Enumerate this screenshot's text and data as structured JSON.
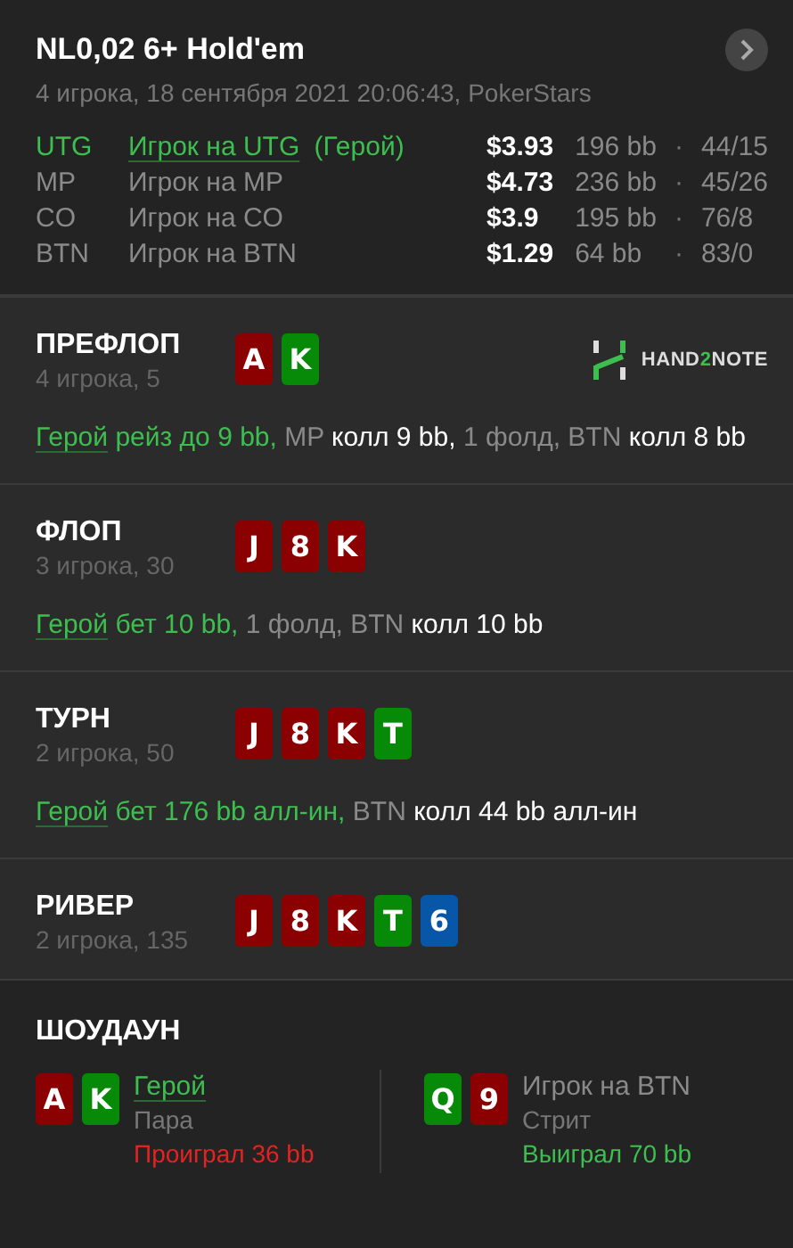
{
  "header": {
    "title": "NL0,02 6+ Hold'em",
    "subtitle": "4 игрока, 18 сентября 2021 20:06:43, PokerStars"
  },
  "players": [
    {
      "position": "UTG",
      "name": "Игрок на UTG",
      "hero_tag": "(Герой)",
      "hero": true,
      "stack": "$3.93",
      "bb": "196 bb",
      "separator": "·",
      "stats": "44/15"
    },
    {
      "position": "MP",
      "name": "Игрок на MP",
      "hero": false,
      "stack": "$4.73",
      "bb": "236 bb",
      "separator": "·",
      "stats": "45/26"
    },
    {
      "position": "CO",
      "name": "Игрок на CO",
      "hero": false,
      "stack": "$3.9",
      "bb": "195 bb",
      "separator": "·",
      "stats": "76/8"
    },
    {
      "position": "BTN",
      "name": "Игрок на BTN",
      "hero": false,
      "stack": "$1.29",
      "bb": "64 bb",
      "separator": "·",
      "stats": "83/0"
    }
  ],
  "logo": [
    "HAND",
    "2",
    "NOTE"
  ],
  "streets": [
    {
      "title": "ПРЕФЛОП",
      "info": "4 игрока, 5",
      "cards": [
        {
          "rank": "A",
          "color": "#8b0000"
        },
        {
          "rank": "K",
          "color": "#078a07"
        }
      ],
      "actions": [
        {
          "kind": "hero",
          "text": "Герой"
        },
        {
          "kind": "hero_action",
          "text": " рейз до 9 bb,"
        },
        {
          "kind": "player",
          "text": " MP"
        },
        {
          "kind": "action",
          "text": " колл 9 bb,"
        },
        {
          "kind": "player",
          "text": " 1 фолд, BTN"
        },
        {
          "kind": "action",
          "text": " колл 8 bb"
        }
      ]
    },
    {
      "title": "ФЛОП",
      "info": "3 игрока, 30",
      "cards": [
        {
          "rank": "J",
          "color": "#8b0000"
        },
        {
          "rank": "8",
          "color": "#8b0000"
        },
        {
          "rank": "K",
          "color": "#8b0000"
        }
      ],
      "actions": [
        {
          "kind": "hero",
          "text": "Герой"
        },
        {
          "kind": "hero_action",
          "text": " бет 10 bb,"
        },
        {
          "kind": "player",
          "text": " 1 фолд, BTN"
        },
        {
          "kind": "action",
          "text": " колл 10 bb"
        }
      ]
    },
    {
      "title": "ТУРН",
      "info": "2 игрока, 50",
      "cards": [
        {
          "rank": "J",
          "color": "#8b0000"
        },
        {
          "rank": "8",
          "color": "#8b0000"
        },
        {
          "rank": "K",
          "color": "#8b0000"
        },
        {
          "rank": "T",
          "color": "#078a07"
        }
      ],
      "actions": [
        {
          "kind": "hero",
          "text": "Герой"
        },
        {
          "kind": "hero_action",
          "text": " бет 176 bb алл-ин,"
        },
        {
          "kind": "player",
          "text": " BTN"
        },
        {
          "kind": "action",
          "text": " колл 44 bb алл-ин"
        }
      ]
    },
    {
      "title": "РИВЕР",
      "info": "2 игрока, 135",
      "cards": [
        {
          "rank": "J",
          "color": "#8b0000"
        },
        {
          "rank": "8",
          "color": "#8b0000"
        },
        {
          "rank": "K",
          "color": "#8b0000"
        },
        {
          "rank": "T",
          "color": "#078a07"
        },
        {
          "rank": "6",
          "color": "#0756a8"
        }
      ]
    }
  ],
  "showdown": {
    "title": "ШОУДАУН",
    "players": [
      {
        "name": "Герой",
        "hero": true,
        "hand": "Пара",
        "result": "Проиграл 36 bb",
        "won": false,
        "cards": [
          {
            "rank": "A",
            "color": "#8b0000"
          },
          {
            "rank": "K",
            "color": "#078a07"
          }
        ]
      },
      {
        "name": "Игрок на BTN",
        "hero": false,
        "hand": "Стрит",
        "result": "Выиграл 70 bb",
        "won": true,
        "cards": [
          {
            "rank": "Q",
            "color": "#078a07"
          },
          {
            "rank": "9",
            "color": "#8b0000"
          }
        ]
      }
    ]
  }
}
